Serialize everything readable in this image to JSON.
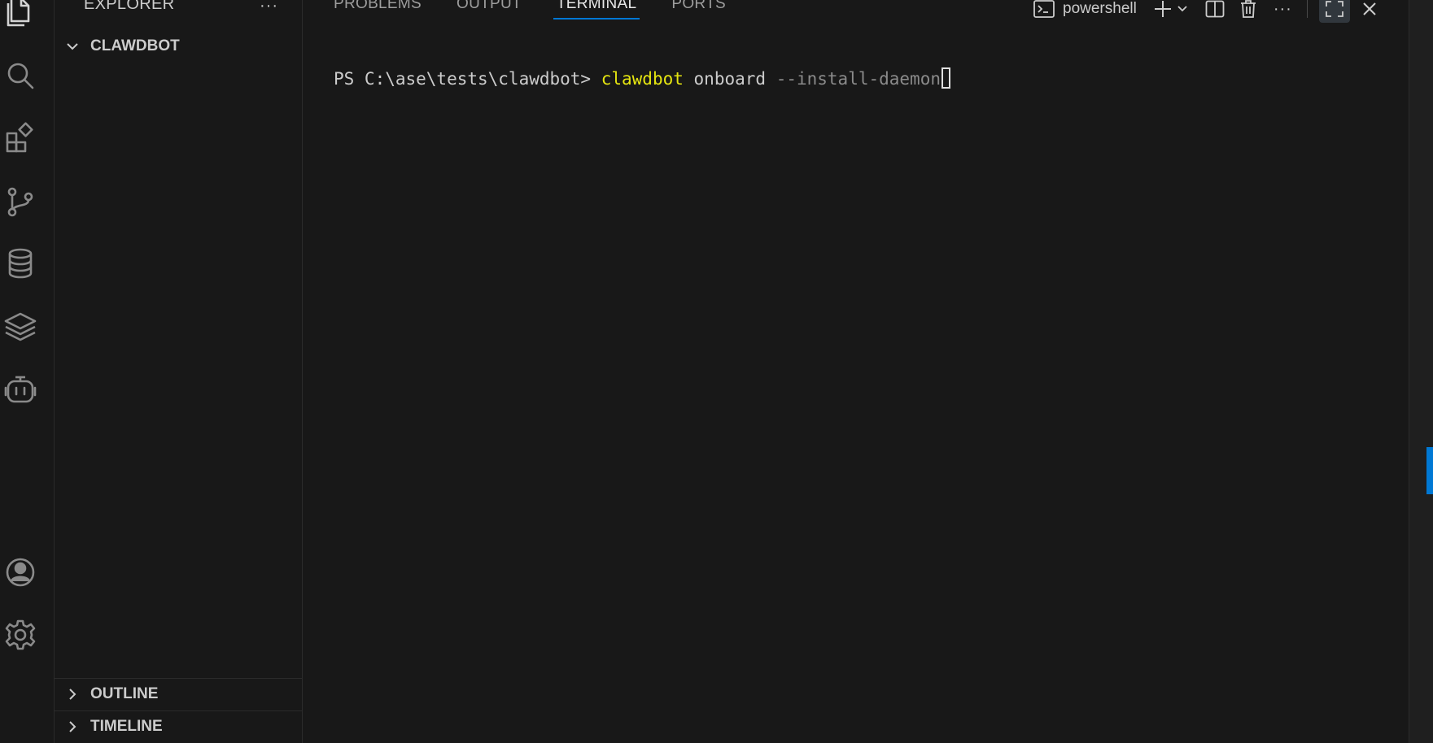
{
  "sidebar": {
    "title": "EXPLORER",
    "more_label": "···",
    "folder": "CLAWDBOT",
    "outline": "OUTLINE",
    "timeline": "TIMELINE"
  },
  "panel": {
    "tabs": [
      {
        "label": "PROBLEMS",
        "active": false
      },
      {
        "label": "OUTPUT",
        "active": false
      },
      {
        "label": "TERMINAL",
        "active": true
      },
      {
        "label": "PORTS",
        "active": false
      }
    ],
    "shell": "powershell",
    "more_label": "···"
  },
  "terminal": {
    "prompt": "PS C:\\ase\\tests\\clawdbot> ",
    "command": "clawdbot",
    "argument": " onboard ",
    "flag": "--install-daemon"
  },
  "colors": {
    "accent": "#0078d4",
    "command": "#e5e510",
    "background": "#181818"
  },
  "icons": {
    "activity_bar": [
      "explorer-icon",
      "search-icon",
      "extensions-icon",
      "source-control-icon",
      "database-icon",
      "layers-icon",
      "copilot-icon",
      "account-icon",
      "settings-icon"
    ]
  }
}
